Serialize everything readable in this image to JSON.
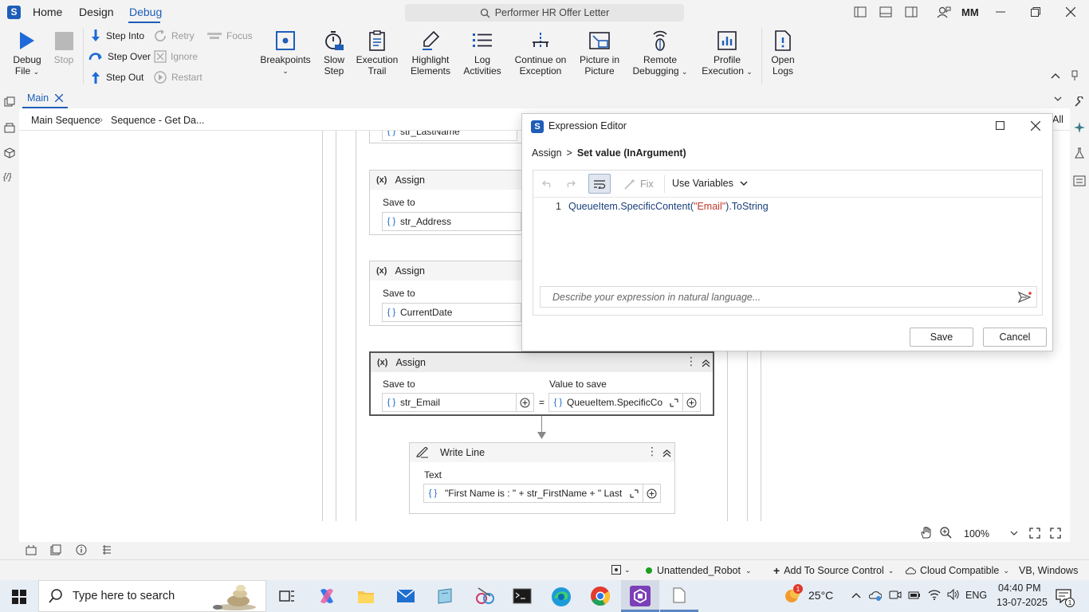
{
  "app": {
    "nav_tabs": [
      "Home",
      "Design",
      "Debug"
    ],
    "active_tab": "Debug",
    "search_title": "Performer HR Offer Letter",
    "user_initials": "MM"
  },
  "ribbon": {
    "debug_file": [
      "Debug",
      "File"
    ],
    "stop": "Stop",
    "step_into": "Step Into",
    "step_over": "Step Over",
    "step_out": "Step Out",
    "retry": "Retry",
    "ignore": "Ignore",
    "restart": "Restart",
    "focus": "Focus",
    "breakpoints": "Breakpoints",
    "slow_step": [
      "Slow",
      "Step"
    ],
    "execution_trail": [
      "Execution",
      "Trail"
    ],
    "highlight_elements": [
      "Highlight",
      "Elements"
    ],
    "log_activities": [
      "Log",
      "Activities"
    ],
    "continue_on_exception": [
      "Continue on",
      "Exception"
    ],
    "picture_in_picture": [
      "Picture in",
      "Picture"
    ],
    "remote_debugging": [
      "Remote",
      "Debugging"
    ],
    "profile_execution": [
      "Profile",
      "Execution"
    ],
    "open_logs": [
      "Open",
      "Logs"
    ]
  },
  "doc": {
    "tab": "Main",
    "breadcrumb": [
      "Main Sequence",
      "Sequence - Get Da..."
    ],
    "right_cut": "All"
  },
  "workflow": {
    "top_partial_field": "str_LastName",
    "assign1": {
      "title": "Assign",
      "save_to": "Save to",
      "variable": "str_Address"
    },
    "assign2": {
      "title": "Assign",
      "save_to": "Save to",
      "variable": "CurrentDate"
    },
    "assign3": {
      "title": "Assign",
      "save_to": "Save to",
      "value_label": "Value to save",
      "variable": "str_Email",
      "value": "QueueItem.SpecificCo",
      "equals": "="
    },
    "writeline": {
      "title": "Write Line",
      "text_label": "Text",
      "value": "\"First Name is : \" + str_FirstName + \" Last"
    },
    "curly": "{ }",
    "assign_badge": "(x)"
  },
  "expression_editor": {
    "title": "Expression Editor",
    "breadcrumb_root": "Assign",
    "breadcrumb_sep": ">",
    "breadcrumb_current": "Set value (InArgument)",
    "fix": "Fix",
    "use_variables": "Use Variables",
    "line_no": "1",
    "code_prefix": "QueueItem.SpecificContent(",
    "code_string": "\"Email\"",
    "code_suffix": ").ToString",
    "nl_placeholder": "Describe your expression in natural language...",
    "save": "Save",
    "cancel": "Cancel"
  },
  "canvas_footer": {
    "zoom": "100%"
  },
  "statusbar": {
    "robot": "Unattended_Robot",
    "source_control": "Add To Source Control",
    "cloud": "Cloud Compatible",
    "lang": "VB, Windows"
  },
  "taskbar": {
    "search_placeholder": "Type here to search",
    "temperature": "25°C",
    "weather_badge": "1",
    "lang": "ENG",
    "time": "04:40 PM",
    "date": "13-07-2025",
    "notif_count": "1"
  },
  "colors": {
    "accent": "#1a66c8",
    "uipath_blue": "#1e5eb8",
    "code_string": "#c0392b",
    "dialog_border": "#c8c8c8"
  }
}
